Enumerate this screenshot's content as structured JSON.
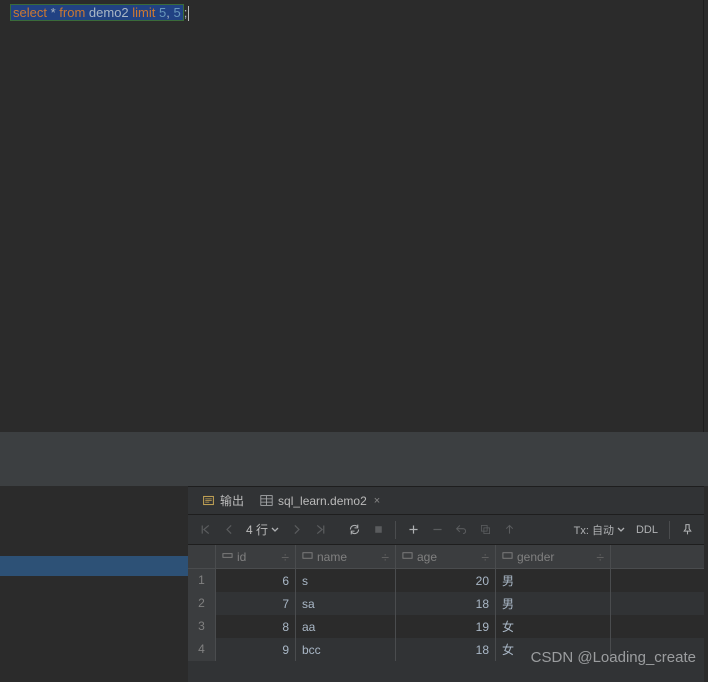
{
  "sql": {
    "select": "select",
    "star": "*",
    "from": "from",
    "table": "demo2",
    "limit": "limit",
    "n1": "5",
    "comma": ",",
    "n2": "5",
    "semi": ";"
  },
  "tabs": {
    "output": "输出",
    "dataset": "sql_learn.demo2"
  },
  "toolbar": {
    "row_count": "4 行",
    "tx": "Tx: 自动",
    "ddl": "DDL"
  },
  "columns": {
    "id": "id",
    "name": "name",
    "age": "age",
    "gender": "gender"
  },
  "rows": [
    {
      "n": "1",
      "id": "6",
      "name": "s",
      "age": "20",
      "gender": "男"
    },
    {
      "n": "2",
      "id": "7",
      "name": "sa",
      "age": "18",
      "gender": "男"
    },
    {
      "n": "3",
      "id": "8",
      "name": "aa",
      "age": "19",
      "gender": "女"
    },
    {
      "n": "4",
      "id": "9",
      "name": "bcc",
      "age": "18",
      "gender": "女"
    }
  ],
  "watermark": "CSDN @Loading_create"
}
